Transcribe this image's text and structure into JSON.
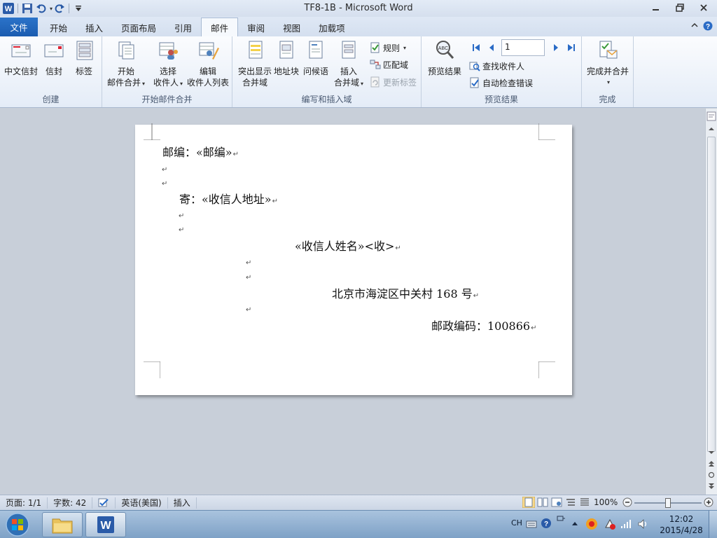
{
  "window": {
    "title": "TF8-1B  -  Microsoft Word"
  },
  "tabs": [
    {
      "label": "文件"
    },
    {
      "label": "开始"
    },
    {
      "label": "插入"
    },
    {
      "label": "页面布局"
    },
    {
      "label": "引用"
    },
    {
      "label": "邮件"
    },
    {
      "label": "审阅"
    },
    {
      "label": "视图"
    },
    {
      "label": "加载项"
    }
  ],
  "ribbon": {
    "create": {
      "label": "创建",
      "cn_envelope": "中文信封",
      "envelope": "信封",
      "labels": "标签"
    },
    "start": {
      "label": "开始邮件合并",
      "start_merge_1": "开始",
      "start_merge_2": "邮件合并",
      "select_1": "选择",
      "select_2": "收件人",
      "edit_1": "编辑",
      "edit_2": "收件人列表"
    },
    "write": {
      "label": "编写和插入域",
      "highlight_1": "突出显示",
      "highlight_2": "合并域",
      "address": "地址块",
      "greeting": "问候语",
      "insert_1": "插入",
      "insert_2": "合并域",
      "rules": "规则",
      "match": "匹配域",
      "update": "更新标签"
    },
    "preview": {
      "label": "预览结果",
      "preview_btn": "预览结果",
      "record": "1",
      "find": "查找收件人",
      "check": "自动检查错误"
    },
    "finish": {
      "label": "完成",
      "finish_btn": "完成并合并"
    }
  },
  "document": {
    "line1": "邮编：«邮编»",
    "line2": "寄：«收信人地址»",
    "line3": "«收信人姓名»<收>",
    "line4": "北京市海淀区中关村 168 号",
    "line5": "邮政编码：100866",
    "para_mark": "↵"
  },
  "status": {
    "page": "页面: 1/1",
    "words": "字数: 42",
    "lang": "英语(美国)",
    "mode": "插入",
    "zoom": "100%"
  },
  "taskbar": {
    "ime": "CH",
    "time": "12:02",
    "date": "2015/4/28"
  }
}
